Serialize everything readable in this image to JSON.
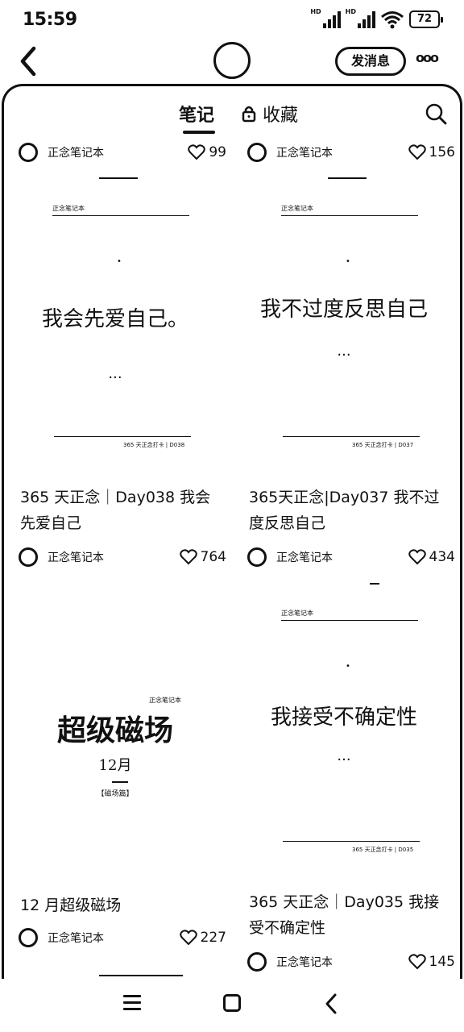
{
  "status_bar": {
    "time": "15:59",
    "battery": "72",
    "network_badges": [
      "HD",
      "HD"
    ]
  },
  "header": {
    "message_button": "发消息",
    "more": "ooo"
  },
  "tabs": {
    "notes": "笔记",
    "favorites": "收藏"
  },
  "top_row": [
    {
      "author": "正念笔记本",
      "likes": "99"
    },
    {
      "author": "正念笔记本",
      "likes": "156"
    }
  ],
  "cards": [
    {
      "cover_text": "我会先爱自己。",
      "ellipsis": "...",
      "title": "365 天正念｜Day038 我会先爱自己",
      "author": "正念笔记本",
      "likes": "764"
    },
    {
      "cover_text": "我不过度反思自己",
      "ellipsis": "...",
      "title": "365天正念|Day037 我不过度反思自己",
      "author": "正念笔记本",
      "likes": "434"
    },
    {
      "cover_text": "超级磁场",
      "cover_sub": "12月",
      "title": "12 月超级磁场",
      "author": "正念笔记本",
      "likes": "227"
    },
    {
      "cover_text": "我接受不确定性",
      "ellipsis": "...",
      "title": "365 天正念｜Day035 我接受不确定性",
      "author": "正念笔记本",
      "likes": "145"
    }
  ]
}
